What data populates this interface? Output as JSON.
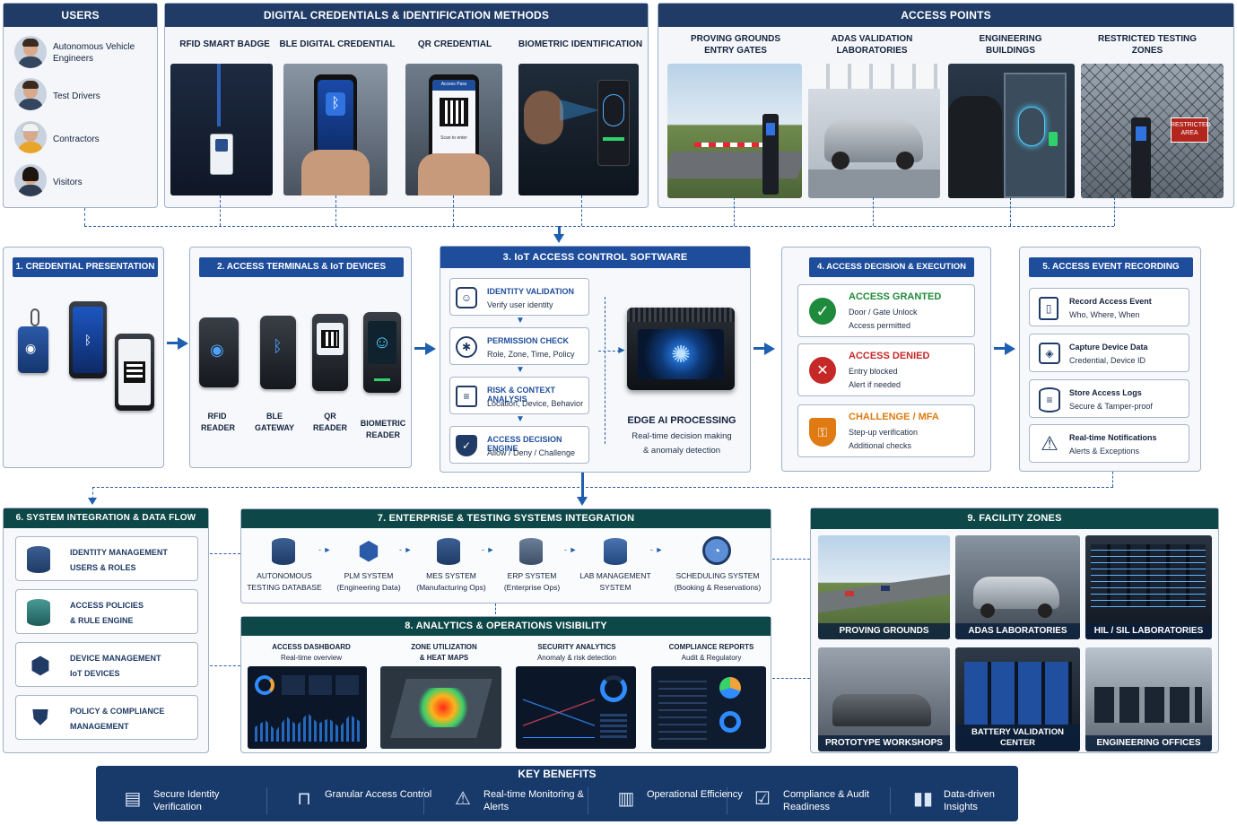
{
  "users": {
    "title": "USERS",
    "items": [
      {
        "label": "Autonomous Vehicle Engineers"
      },
      {
        "label": "Test Drivers"
      },
      {
        "label": "Contractors"
      },
      {
        "label": "Visitors"
      }
    ]
  },
  "credentials": {
    "title": "DIGITAL CREDENTIALS & IDENTIFICATION METHODS",
    "items": [
      {
        "label": "RFID SMART BADGE"
      },
      {
        "label": "BLE DIGITAL CREDENTIAL"
      },
      {
        "label": "QR CREDENTIAL"
      },
      {
        "label": "BIOMETRIC IDENTIFICATION"
      }
    ],
    "qr_screen_title": "Access Pass",
    "qr_screen_hint": "Scan to enter"
  },
  "access_points": {
    "title": "ACCESS POINTS",
    "items": [
      {
        "label": "PROVING GROUNDS ENTRY GATES"
      },
      {
        "label": "ADAS VALIDATION LABORATORIES"
      },
      {
        "label": "ENGINEERING BUILDINGS"
      },
      {
        "label": "RESTRICTED TESTING ZONES"
      }
    ],
    "restricted_sign": "RESTRICTED AREA"
  },
  "step1": {
    "title": "1. CREDENTIAL PRESENTATION"
  },
  "step2": {
    "title": "2. ACCESS TERMINALS & IoT DEVICES",
    "devices": [
      {
        "label": "RFID READER"
      },
      {
        "label": "BLE GATEWAY"
      },
      {
        "label": "QR READER"
      },
      {
        "label": "BIOMETRIC READER"
      }
    ]
  },
  "step3": {
    "title": "3. IoT ACCESS CONTROL SOFTWARE",
    "checks": [
      {
        "title": "IDENTITY VALIDATION",
        "desc": "Verify user identity"
      },
      {
        "title": "PERMISSION CHECK",
        "desc": "Role, Zone, Time, Policy"
      },
      {
        "title": "RISK & CONTEXT ANALYSIS",
        "desc": "Location, Device, Behavior"
      },
      {
        "title": "ACCESS DECISION ENGINE",
        "desc": "Allow / Deny / Challenge"
      }
    ],
    "edge_title": "EDGE AI PROCESSING",
    "edge_desc1": "Real-time decision making",
    "edge_desc2": "& anomaly detection"
  },
  "step4": {
    "title": "4. ACCESS DECISION & EXECUTION",
    "outcomes": [
      {
        "title": "ACCESS GRANTED",
        "line1": "Door / Gate Unlock",
        "line2": "Access permitted",
        "color": "#1e8a3c"
      },
      {
        "title": "ACCESS DENIED",
        "line1": "Entry blocked",
        "line2": "Alert if needed",
        "color": "#c62828"
      },
      {
        "title": "CHALLENGE / MFA",
        "line1": "Step-up verification",
        "line2": "Additional checks",
        "color": "#e07a12"
      }
    ]
  },
  "step5": {
    "title": "5. ACCESS EVENT RECORDING",
    "items": [
      {
        "title": "Record Access Event",
        "desc": "Who, Where, When"
      },
      {
        "title": "Capture Device Data",
        "desc": "Credential, Device ID"
      },
      {
        "title": "Store Access Logs",
        "desc": "Secure & Tamper-proof"
      },
      {
        "title": "Real-time Notifications",
        "desc": "Alerts & Exceptions"
      }
    ]
  },
  "step6": {
    "title": "6. SYSTEM INTEGRATION & DATA FLOW",
    "items": [
      {
        "line1": "IDENTITY MANAGEMENT",
        "line2": "USERS & ROLES"
      },
      {
        "line1": "ACCESS POLICIES",
        "line2": "& RULE ENGINE"
      },
      {
        "line1": "DEVICE MANAGEMENT",
        "line2": "IoT DEVICES"
      },
      {
        "line1": "POLICY & COMPLIANCE",
        "line2": "MANAGEMENT"
      }
    ]
  },
  "step7": {
    "title": "7. ENTERPRISE & TESTING SYSTEMS INTEGRATION",
    "systems": [
      {
        "line1": "AUTONOMOUS",
        "line2": "TESTING DATABASE"
      },
      {
        "line1": "PLM SYSTEM",
        "line2": "(Engineering Data)"
      },
      {
        "line1": "MES SYSTEM",
        "line2": "(Manufacturing Ops)"
      },
      {
        "line1": "ERP SYSTEM",
        "line2": "(Enterprise Ops)"
      },
      {
        "line1": "LAB MANAGEMENT",
        "line2": "SYSTEM"
      },
      {
        "line1": "SCHEDULING SYSTEM",
        "line2": "(Booking & Reservations)"
      }
    ]
  },
  "step8": {
    "title": "8. ANALYTICS & OPERATIONS VISIBILITY",
    "dashboards": [
      {
        "line1": "ACCESS DASHBOARD",
        "line2": "Real-time overview"
      },
      {
        "line1": "ZONE UTILIZATION",
        "line2": "& HEAT MAPS"
      },
      {
        "line1": "SECURITY ANALYTICS",
        "line2": "Anomaly & risk detection"
      },
      {
        "line1": "COMPLIANCE REPORTS",
        "line2": "Audit & Regulatory"
      }
    ]
  },
  "step9": {
    "title": "9. FACILITY ZONES",
    "zones": [
      {
        "label": "PROVING GROUNDS"
      },
      {
        "label": "ADAS LABORATORIES"
      },
      {
        "label": "HIL / SIL LABORATORIES"
      },
      {
        "label": "PROTOTYPE WORKSHOPS"
      },
      {
        "label": "BATTERY VALIDATION CENTER"
      },
      {
        "label": "ENGINEERING OFFICES"
      }
    ]
  },
  "benefits": {
    "title": "KEY BENEFITS",
    "items": [
      {
        "label": "Secure Identity Verification",
        "icon": "id-card-icon"
      },
      {
        "label": "Granular Access Control",
        "icon": "lock-icon"
      },
      {
        "label": "Real-time Monitoring & Alerts",
        "icon": "warning-icon"
      },
      {
        "label": "Operational Efficiency",
        "icon": "factory-icon"
      },
      {
        "label": "Compliance & Audit Readiness",
        "icon": "checklist-icon"
      },
      {
        "label": "Data-driven Insights",
        "icon": "bar-chart-icon"
      }
    ]
  },
  "colors": {
    "navy": "#1f3b66",
    "teal": "#0e4747",
    "accent": "#1e4d9c",
    "arrow": "#1f5fb0"
  }
}
